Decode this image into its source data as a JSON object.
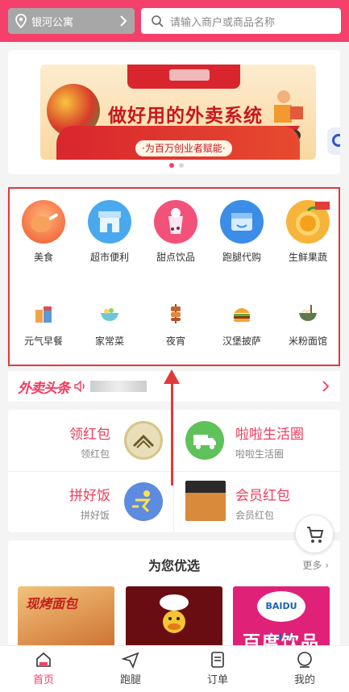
{
  "header": {
    "location": "银河公寓",
    "search_placeholder": "请输入商户或商品名称"
  },
  "banner": {
    "headline": "做好用的外卖系统",
    "slogan": "·为百万创业者赋能·"
  },
  "categories": [
    {
      "label": "美食",
      "icon": "fried-chicken-icon"
    },
    {
      "label": "超市便利",
      "icon": "store-icon"
    },
    {
      "label": "甜点饮品",
      "icon": "milk-tea-icon"
    },
    {
      "label": "跑腿代购",
      "icon": "delivery-box-icon"
    },
    {
      "label": "生鲜果蔬",
      "icon": "orange-icon"
    },
    {
      "label": "元气早餐",
      "icon": "breakfast-icon"
    },
    {
      "label": "家常菜",
      "icon": "bowl-icon"
    },
    {
      "label": "夜宵",
      "icon": "skewer-icon"
    },
    {
      "label": "汉堡披萨",
      "icon": "burger-icon"
    },
    {
      "label": "米粉面馆",
      "icon": "noodle-icon"
    }
  ],
  "news": {
    "brand": "外卖头条"
  },
  "promos": [
    {
      "title": "领红包",
      "subtitle": "领红包"
    },
    {
      "title": "啦啦生活圈",
      "subtitle": "啦啦生活圈"
    },
    {
      "title": "拼好饭",
      "subtitle": "拼好饭"
    },
    {
      "title": "会员红包",
      "subtitle": "会员红包"
    }
  ],
  "recommend": {
    "title": "为您优选",
    "more": "更多",
    "cards": [
      {
        "text": "现烤面包"
      },
      {
        "text": ""
      },
      {
        "text": "百度饮品",
        "logo": "BAIDU drink"
      }
    ]
  },
  "tabs": [
    {
      "label": "首页",
      "active": true
    },
    {
      "label": "跑腿"
    },
    {
      "label": "订单"
    },
    {
      "label": "我的"
    }
  ],
  "colors": {
    "brand": "#f4406a",
    "highlight": "#e03a3a"
  }
}
